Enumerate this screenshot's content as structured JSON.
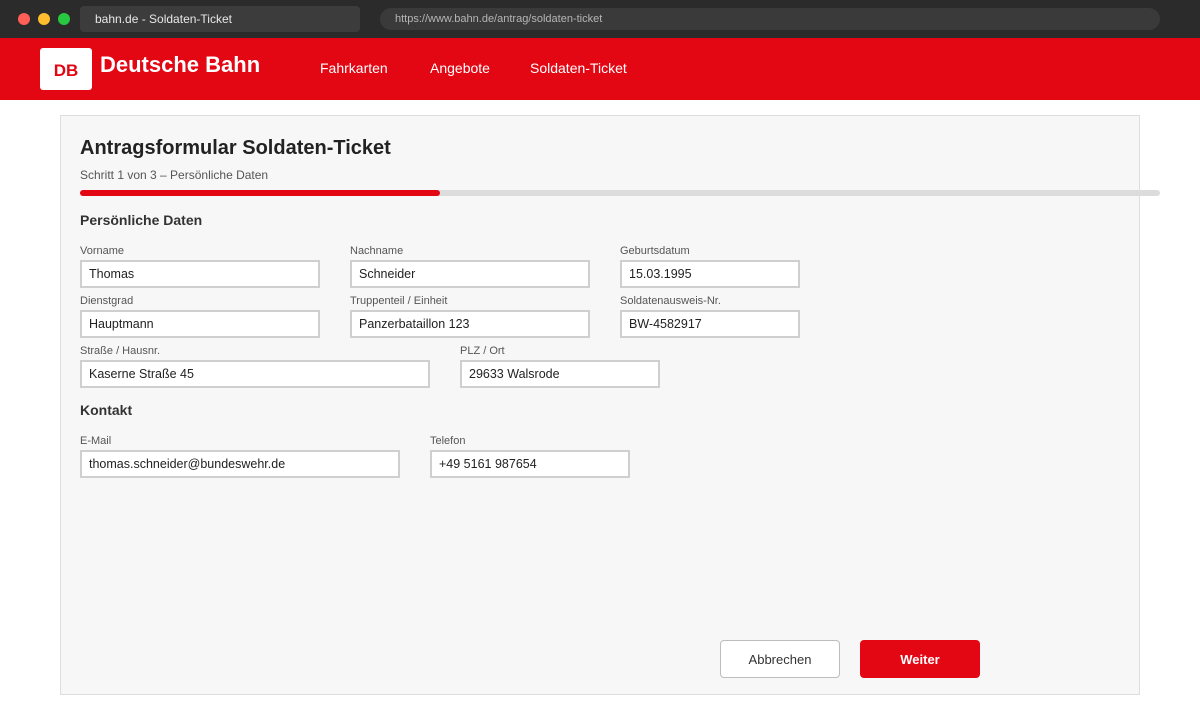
{
  "browser": {
    "tab_title": "bahn.de - Soldaten-Ticket",
    "url": "https://www.bahn.de/antrag/soldaten-ticket"
  },
  "header": {
    "logo_text": "DB",
    "brand": "Deutsche Bahn",
    "nav": [
      "Fahrkarten",
      "Angebote",
      "Soldaten-Ticket"
    ]
  },
  "form": {
    "title": "Antragsformular Soldaten-Ticket",
    "step_text": "Schritt 1 von 3 – Persönliche Daten",
    "progress": 0.333,
    "sections": {
      "personal": "Persönliche Daten",
      "contact": "Kontakt"
    },
    "fields": {
      "vorname": {
        "label": "Vorname",
        "value": "Thomas"
      },
      "nachname": {
        "label": "Nachname",
        "value": "Schneider"
      },
      "geburtsdatum": {
        "label": "Geburtsdatum",
        "value": "15.03.1995"
      },
      "dienstgrad": {
        "label": "Dienstgrad",
        "value": "Hauptmann"
      },
      "truppenteil": {
        "label": "Truppenteil / Einheit",
        "value": "Panzerbataillon 123"
      },
      "ausweis": {
        "label": "Soldatenausweis-Nr.",
        "value": "BW-4582917"
      },
      "strasse": {
        "label": "Straße / Hausnr.",
        "value": "Kaserne Straße 45"
      },
      "plz_ort": {
        "label": "PLZ / Ort",
        "value": "29633 Walsrode"
      },
      "email": {
        "label": "E-Mail",
        "value": "thomas.schneider@bundeswehr.de"
      },
      "telefon": {
        "label": "Telefon",
        "value": "+49 5161 987654"
      }
    },
    "buttons": {
      "cancel": "Abbrechen",
      "next": "Weiter"
    }
  },
  "colors": {
    "brand_red": "#e30613",
    "card_bg": "#f7f7f7"
  }
}
